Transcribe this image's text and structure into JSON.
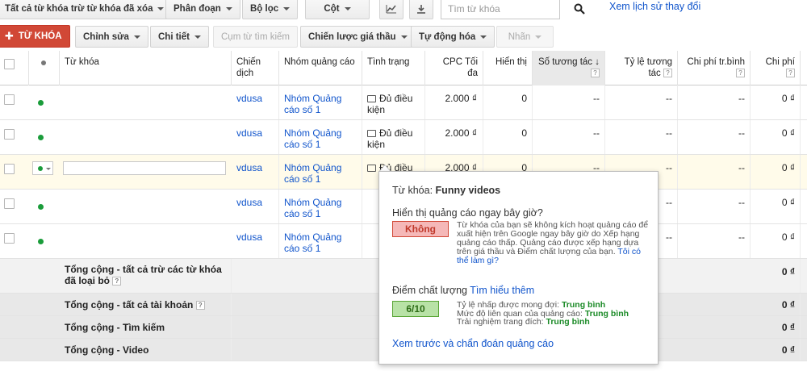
{
  "toolbar1": {
    "filter_label": "Tất cả từ khóa trừ từ khóa đã xóa",
    "segment_label": "Phân đoạn",
    "filter2_label": "Bộ lọc",
    "columns_label": "Cột",
    "search_placeholder": "Tìm từ khóa",
    "history_link": "Xem lịch sử thay đổi"
  },
  "toolbar2": {
    "add_keyword": "TỪ KHÓA",
    "edit": "Chỉnh sửa",
    "details": "Chi tiết",
    "search_terms": "Cụm từ tìm kiếm",
    "bid_strategy": "Chiến lược giá thầu",
    "automate": "Tự động hóa",
    "labels": "Nhãn"
  },
  "columns": {
    "keyword": "Từ khóa",
    "campaign": "Chiến dịch",
    "adgroup": "Nhóm quảng cáo",
    "status": "Tình trạng",
    "maxcpc": "CPC Tối đa",
    "impressions": "Hiển thị",
    "interactions": "Số tương tác",
    "interaction_rate": "Tỷ lệ tương tác",
    "avg_cost": "Chi phí tr.bình",
    "cost": "Chi phí"
  },
  "rows": [
    {
      "campaign": "vdusa",
      "adgroup": "Nhóm Quảng cáo số 1",
      "status": "Đủ điều kiện",
      "maxcpc": "2.000 ₫",
      "impressions": "0",
      "interactions": "--",
      "interaction_rate": "--",
      "avg_cost": "--",
      "cost": "0 ₫"
    },
    {
      "campaign": "vdusa",
      "adgroup": "Nhóm Quảng cáo số 1",
      "status": "Đủ điều kiện",
      "maxcpc": "2.000 ₫",
      "impressions": "0",
      "interactions": "--",
      "interaction_rate": "--",
      "avg_cost": "--",
      "cost": "0 ₫"
    },
    {
      "campaign": "vdusa",
      "adgroup": "Nhóm Quảng cáo số 1",
      "status": "Đủ điều",
      "maxcpc": "2.000 ₫",
      "impressions": "0",
      "interactions": "--",
      "interaction_rate": "--",
      "avg_cost": "--",
      "cost": "0 ₫"
    },
    {
      "campaign": "vdusa",
      "adgroup": "Nhóm Quảng cáo số 1",
      "status": "",
      "maxcpc": "",
      "impressions": "",
      "interactions": "",
      "interaction_rate": "--",
      "avg_cost": "--",
      "cost": "0 ₫"
    },
    {
      "campaign": "vdusa",
      "adgroup": "Nhóm Quảng cáo số 1",
      "status": "",
      "maxcpc": "",
      "impressions": "",
      "interactions": "",
      "interaction_rate": "--",
      "avg_cost": "--",
      "cost": "0 ₫"
    }
  ],
  "totals": [
    {
      "label": "Tổng cộng - tất cả trừ các từ khóa đã loại bỏ",
      "cost": "0 ₫"
    },
    {
      "label": "Tổng cộng - tất cả tài khoản",
      "cost": "0 ₫"
    },
    {
      "label": "Tổng cộng - Tìm kiếm",
      "cost": "0 ₫"
    },
    {
      "label": "Tổng cộng - Video",
      "cost": "0 ₫"
    }
  ],
  "popup": {
    "keyword_label": "Từ khóa:",
    "keyword_value": "Funny videos",
    "question": "Hiển thị quảng cáo ngay bây giờ?",
    "badge_no": "Không",
    "explanation": "Từ khóa của bạn sẽ không kích hoạt quảng cáo để xuất hiện trên Google ngay bây giờ do Xếp hạng quảng cáo thấp. Quảng cáo được xếp hạng dựa trên giá thầu và Điểm chất lượng của bạn.",
    "explanation_link": "Tôi có thể làm gì?",
    "quality_label": "Điểm chất lượng",
    "learn_more": "Tìm hiểu thêm",
    "score": "6/10",
    "ctr_label": "Tỷ lệ nhấp được mong đợi:",
    "ctr_value": "Trung bình",
    "relevance_label": "Mức độ liên quan của quảng cáo:",
    "relevance_value": "Trung bình",
    "landing_label": "Trải nghiệm trang đích:",
    "landing_value": "Trung bình",
    "preview_link": "Xem trước và chẩn đoán quảng cáo"
  }
}
